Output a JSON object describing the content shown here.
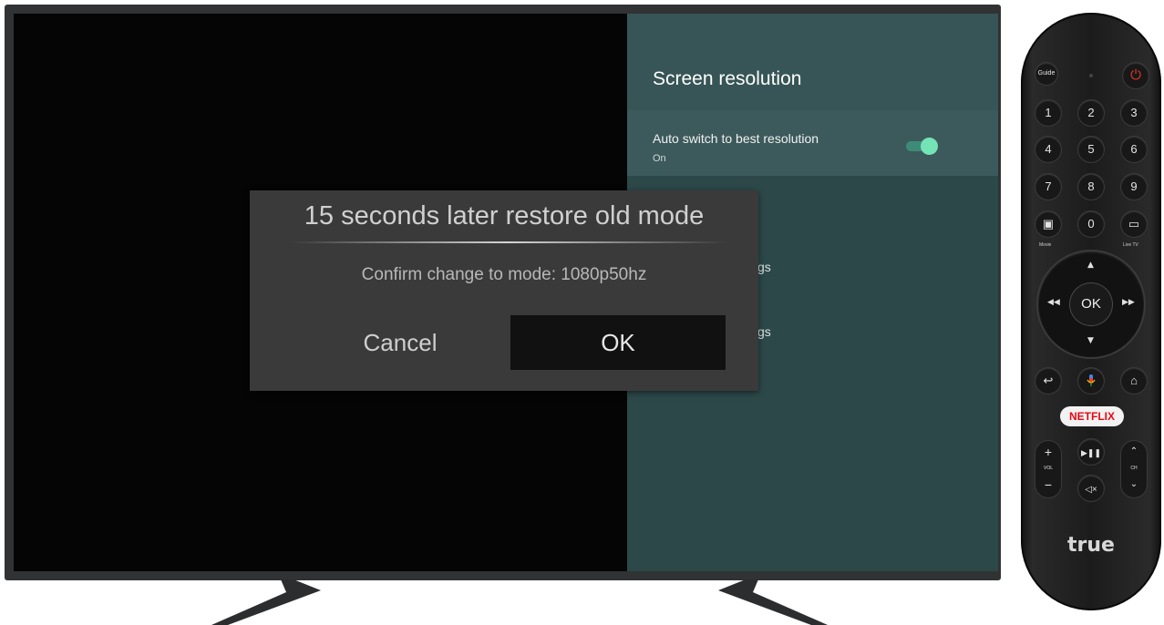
{
  "settings": {
    "title": "Screen resolution",
    "auto_switch": {
      "label": "Auto switch to best resolution",
      "value": "On",
      "enabled": true
    },
    "partial_labels": [
      "gs",
      "gs"
    ]
  },
  "dialog": {
    "title": "15 seconds later restore old mode",
    "message": "Confirm change to mode: 1080p50hz",
    "cancel_label": "Cancel",
    "ok_label": "OK"
  },
  "remote": {
    "guide_label": "Guide",
    "number_keys": [
      "1",
      "2",
      "3",
      "4",
      "5",
      "6",
      "7",
      "8",
      "9",
      "0"
    ],
    "movie_label": "Movie",
    "livetv_label": "Live TV",
    "ok_label": "OK",
    "netflix_label": "NETFLIX",
    "vol_label": "VOL",
    "ch_label": "CH",
    "brand": "true"
  },
  "colors": {
    "panel_bg": "#2c4849",
    "toggle_on": "#74e3b6",
    "netflix_red": "#e50914",
    "power_red": "#e0362b"
  }
}
